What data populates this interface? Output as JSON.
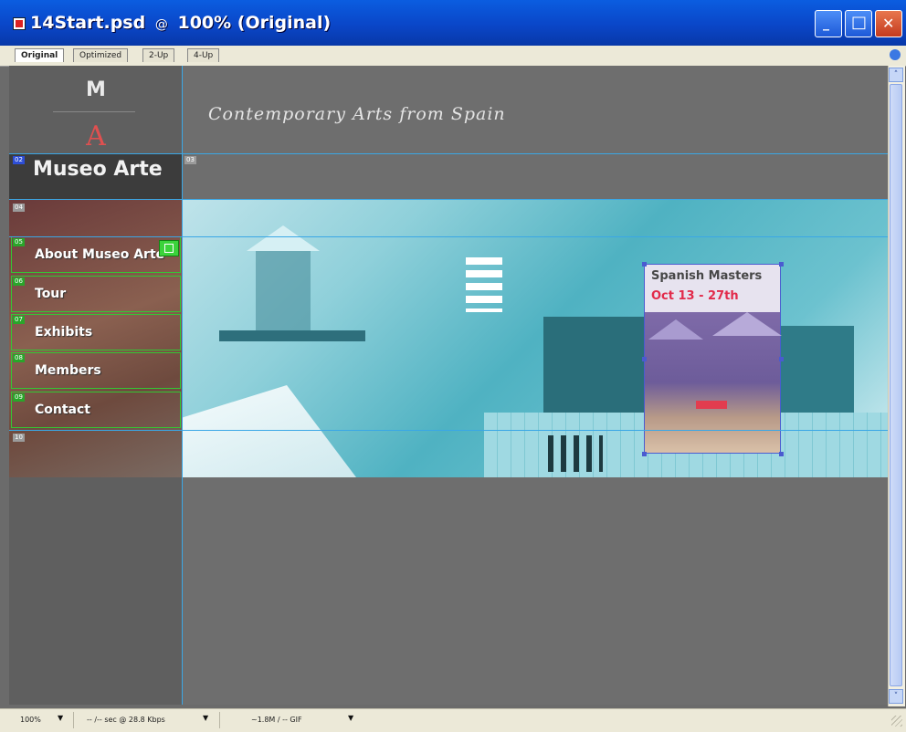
{
  "window": {
    "title": "14Start.psd",
    "zoom_title": "100% (Original)",
    "at_symbol": "@",
    "minimize_glyph": "_",
    "maximize_glyph": "□",
    "close_glyph": "✕"
  },
  "tabs": [
    "Original",
    "Optimized",
    "2-Up",
    "4-Up"
  ],
  "site": {
    "logo_m": "M",
    "logo_a": "A",
    "tagline": "Contemporary Arts from Spain",
    "museum_name": "Museo Arte",
    "nav": [
      "About Museo Arte",
      "Tour",
      "Exhibits",
      "Members",
      "Contact"
    ],
    "feature_title": "Spanish Masters",
    "feature_dates": "Oct 13 - 27th"
  },
  "slices": {
    "top_left": "02",
    "museum_right": "03",
    "nav_header": "04",
    "nav": [
      "05",
      "06",
      "07",
      "08",
      "09"
    ],
    "footer": "10"
  },
  "status": {
    "zoom": "100%",
    "download": "-- /-- sec @ 28.8 Kbps",
    "size": "~1.8M / -- GIF"
  },
  "scrollbar": {
    "up_glyph": "˄",
    "down_glyph": "˅"
  },
  "colors": {
    "titlebar": "#0a46c8",
    "accent_red": "#e22a4a",
    "slice_border": "#33c833",
    "guide": "#3aa7e6"
  }
}
